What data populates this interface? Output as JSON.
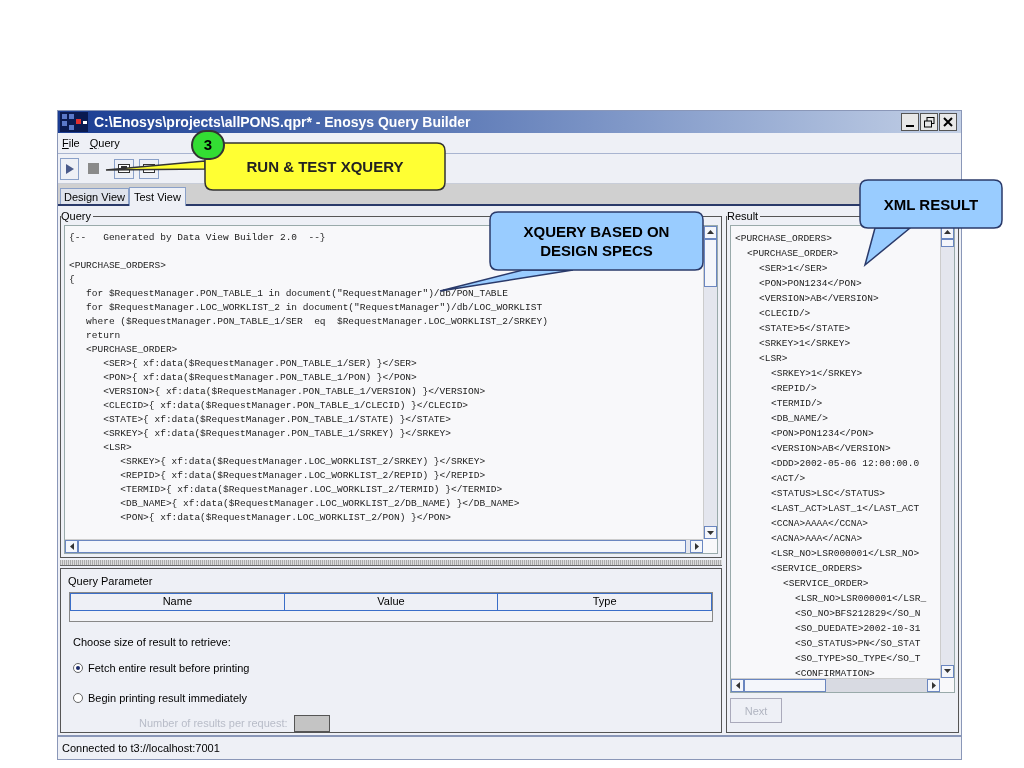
{
  "window": {
    "title": "C:\\Enosys\\projects\\allPONS.qpr* - Enosys Query Builder"
  },
  "menu": [
    "File",
    "Query"
  ],
  "tabs": [
    {
      "label": "Design View",
      "selected": false
    },
    {
      "label": "Test View",
      "selected": true
    }
  ],
  "query_panel": {
    "title": "Query",
    "comment": "{--   Generated by Data View Builder 2.0  --}",
    "lines": [
      "<PURCHASE_ORDERS>",
      "{",
      "   for $RequestManager.PON_TABLE_1 in document(\"RequestManager\")/db/PON_TABLE",
      "   for $RequestManager.LOC_WORKLIST_2 in document(\"RequestManager\")/db/LOC_WORKLIST",
      "   where ($RequestManager.PON_TABLE_1/SER  eq  $RequestManager.LOC_WORKLIST_2/SRKEY)",
      "   return",
      "   <PURCHASE_ORDER>",
      "      <SER>{ xf:data($RequestManager.PON_TABLE_1/SER) }</SER>",
      "      <PON>{ xf:data($RequestManager.PON_TABLE_1/PON) }</PON>",
      "      <VERSION>{ xf:data($RequestManager.PON_TABLE_1/VERSION) }</VERSION>",
      "      <CLECID>{ xf:data($RequestManager.PON_TABLE_1/CLECID) }</CLECID>",
      "      <STATE>{ xf:data($RequestManager.PON_TABLE_1/STATE) }</STATE>",
      "      <SRKEY>{ xf:data($RequestManager.PON_TABLE_1/SRKEY) }</SRKEY>",
      "      <LSR>",
      "         <SRKEY>{ xf:data($RequestManager.LOC_WORKLIST_2/SRKEY) }</SRKEY>",
      "         <REPID>{ xf:data($RequestManager.LOC_WORKLIST_2/REPID) }</REPID>",
      "         <TERMID>{ xf:data($RequestManager.LOC_WORKLIST_2/TERMID) }</TERMID>",
      "         <DB_NAME>{ xf:data($RequestManager.LOC_WORKLIST_2/DB_NAME) }</DB_NAME>",
      "         <PON>{ xf:data($RequestManager.LOC_WORKLIST_2/PON) }</PON>"
    ]
  },
  "result_panel": {
    "title": "Result",
    "tree": [
      {
        "text": "<PURCHASE_ORDERS>",
        "children": [
          {
            "text": "<PURCHASE_ORDER>",
            "children": [
              {
                "text": "<SER>1</SER>"
              },
              {
                "text": "<PON>PON1234</PON>"
              },
              {
                "text": "<VERSION>AB</VERSION>"
              },
              {
                "text": "<CLECID/>"
              },
              {
                "text": "<STATE>5</STATE>"
              },
              {
                "text": "<SRKEY>1</SRKEY>"
              },
              {
                "text": "<LSR>",
                "children": [
                  {
                    "text": "<SRKEY>1</SRKEY>"
                  },
                  {
                    "text": "<REPID/>"
                  },
                  {
                    "text": "<TERMID/>"
                  },
                  {
                    "text": "<DB_NAME/>"
                  },
                  {
                    "text": "<PON>PON1234</PON>"
                  },
                  {
                    "text": "<VERSION>AB</VERSION>"
                  },
                  {
                    "text": "<DDD>2002-05-06 12:00:00.0"
                  },
                  {
                    "text": "<ACT/>"
                  },
                  {
                    "text": "<STATUS>LSC</STATUS>"
                  },
                  {
                    "text": "<LAST_ACT>LAST_1</LAST_ACT"
                  },
                  {
                    "text": "<CCNA>AAAA</CCNA>"
                  },
                  {
                    "text": "<ACNA>AAA</ACNA>"
                  },
                  {
                    "text": "<LSR_NO>LSR000001</LSR_NO>"
                  },
                  {
                    "text": "<SERVICE_ORDERS>",
                    "children": [
                      {
                        "text": "<SERVICE_ORDER>",
                        "children": [
                          {
                            "text": "<LSR_NO>LSR000001</LSR_"
                          },
                          {
                            "text": "<SO_NO>BFS212829</SO_N"
                          },
                          {
                            "text": "<SO_DUEDATE>2002-10-31"
                          },
                          {
                            "text": "<SO_STATUS>PN</SO_STAT"
                          },
                          {
                            "text": "<SO_TYPE>SO_TYPE</SO_T"
                          },
                          {
                            "text": "<CONFIRMATION>"
                          }
                        ]
                      }
                    ]
                  }
                ]
              }
            ]
          }
        ]
      }
    ],
    "next_button": {
      "label": "Next",
      "disabled": true
    }
  },
  "query_parameter": {
    "title": "Query Parameter",
    "columns": [
      "Name",
      "Value",
      "Type"
    ]
  },
  "result_size": {
    "prompt": "Choose size of result to retrieve:",
    "options": [
      {
        "label": "Fetch entire result before printing",
        "selected": true
      },
      {
        "label": "Begin printing result immediately",
        "selected": false
      }
    ],
    "per_request": {
      "label": "Number of results per request:",
      "disabled": true
    }
  },
  "status_bar": "Connected to t3://localhost:7001",
  "callouts": [
    {
      "kind": "numbered",
      "number": "3",
      "text": "RUN & TEST XQUERY"
    },
    {
      "kind": "plain",
      "text": "XQUERY BASED ON DESIGN SPECS"
    },
    {
      "kind": "plain",
      "text": "XML RESULT"
    }
  ]
}
